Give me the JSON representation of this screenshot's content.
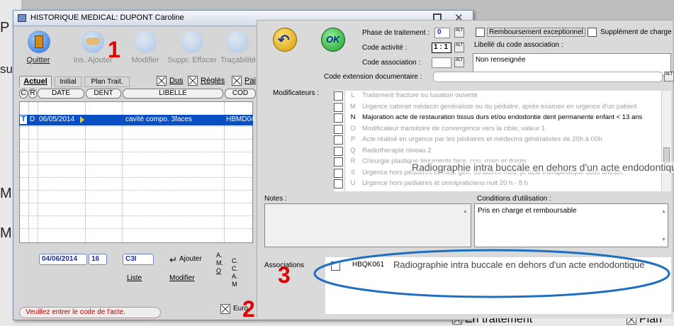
{
  "background": {
    "left_fragments": [
      "P",
      "su",
      "M",
      "M"
    ],
    "bottom_items": [
      "En traitement",
      "Plan"
    ]
  },
  "history_window": {
    "title": "HISTORIQUE MEDICAL: DUPONT Caroline",
    "toolbar": {
      "quit": "Quitter",
      "add": "Ins. Ajouter",
      "modify": "Modifier",
      "delete": "Suppr. Effacer",
      "trace": "Traçabilité"
    },
    "tabs": [
      "Actuel",
      "Initial",
      "Plan Trait."
    ],
    "filters": {
      "dus": "Dus",
      "regles": "Réglés",
      "pai": "Pai"
    },
    "columns": [
      "C",
      "R",
      "DATE",
      "DENT",
      "LIBELLE",
      "COD"
    ],
    "selected_row": {
      "c": "T",
      "r": "D",
      "date": "06/05/2014",
      "dent": "",
      "libelle": "cavité compo. 3faces",
      "code": "HBMD04"
    },
    "input_date": "04/06/2014",
    "input_dent": "16",
    "input_code": "C3I",
    "liste_label": "Liste",
    "ajouter_label": "Ajouter",
    "modifier_label": "Modifier",
    "amo_letters": [
      "A.",
      "M.",
      "O"
    ],
    "ccam_letters": [
      "C.",
      "C.",
      "A.",
      "M"
    ],
    "status_message": "Veuillez entrer le code de l'acte.",
    "euro_label": "Euro"
  },
  "annotations": {
    "one": "1",
    "two": "2",
    "three": "3"
  },
  "dialog": {
    "phase_label": "Phase de traitement :",
    "phase_value": "0",
    "activite_label": "Code activité :",
    "activite_value": "1 : 1",
    "association_label": "Code association :",
    "association_value": "",
    "alt_label": "ALT",
    "remboursement_label": "Remboursement exceptionnel",
    "supplement_label": "Supplément de charge",
    "libelle_assoc_label": "Libellé du code association :",
    "libelle_assoc_value": "Non renseignée",
    "extension_label": "Code extension documentaire :",
    "extension_value": "",
    "modificateurs_label": "Modificateurs :",
    "modifiers": [
      {
        "code": "L",
        "text": "Traitement fracture ou luxation ouverte",
        "enabled": false
      },
      {
        "code": "M",
        "text": "Urgence cabinet médecin généraliste ou du pédiatre, après examen en urgence d'un patient",
        "enabled": false
      },
      {
        "code": "N",
        "text": "Majoration acte de restauration tissus durs et/ou endodontie dent permanente enfant < 13 ans",
        "enabled": true
      },
      {
        "code": "O",
        "text": "Modificateur transitoire de convergence vers la cible, valeur 1",
        "enabled": false
      },
      {
        "code": "P",
        "text": "Acte réalisé en urgence par les pédiatres et médecins généralistes de 20h à 00h",
        "enabled": false
      },
      {
        "code": "Q",
        "text": "Radiotherapie niveau 2",
        "enabled": false
      },
      {
        "code": "R",
        "text": "Chirurgie plastique téguments face, cou, main et doigts",
        "enabled": false
      },
      {
        "code": "S",
        "text": "Urgence hors pédiatres et méd. gén. ou autres méd. pr acte thérapeutique sous anesth.",
        "enabled": false
      },
      {
        "code": "U",
        "text": "Urgence hors pediatres et omnipraticiens nuit 20 h - 8 h",
        "enabled": false
      }
    ],
    "tooltip_text": "Radiographie intra buccale en dehors  d'un acte endodontique",
    "notes_label": "Notes :",
    "notes_value": "",
    "conditions_label": "Conditions d'utilisation :",
    "conditions_value": "Pris en charge et remboursable",
    "associations_label": "Associations",
    "association_code": "HBQK061",
    "association_text": "Radiographie intra buccale en dehors  d'un acte endodontique"
  },
  "colors": {
    "selection": "#0a4fc2",
    "annotation_red": "#e00000",
    "ellipse_blue": "#1e6fc0",
    "field_blue": "#1a2da0"
  }
}
